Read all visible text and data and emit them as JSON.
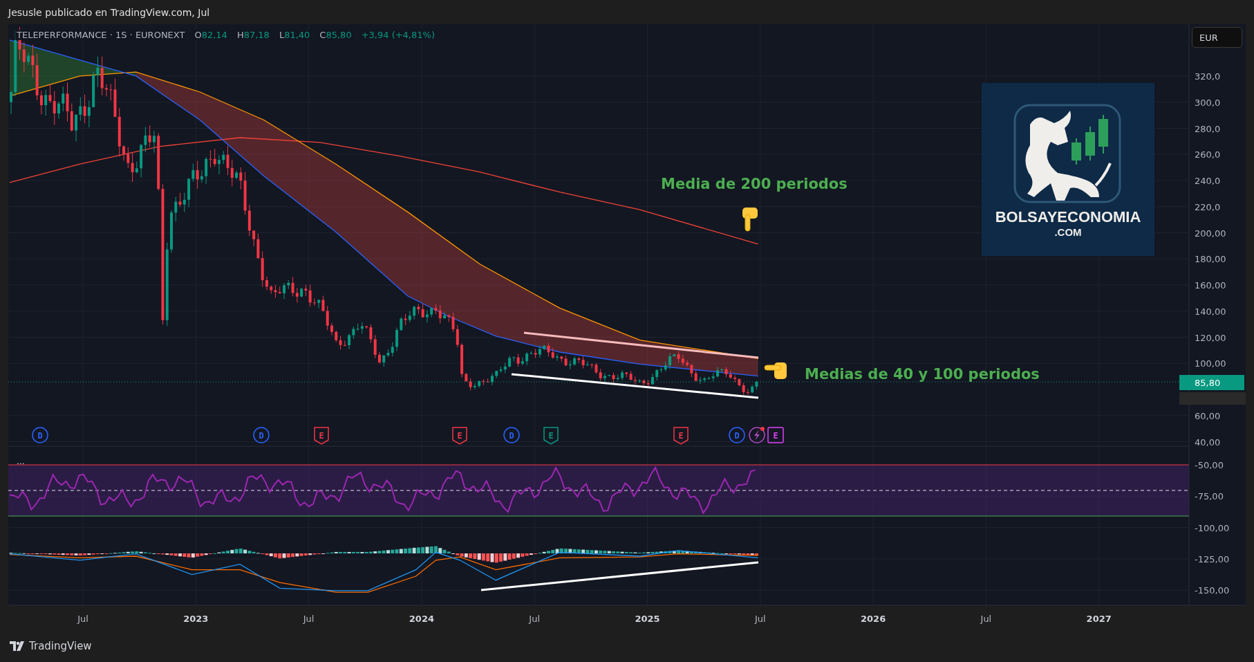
{
  "header": {
    "title": "Jesusle publicado en TradingView.com, Jul"
  },
  "legend": {
    "symbol": "TELEPERFORMANCE · 1S · EURONEXT",
    "values": [
      {
        "label": "O",
        "value": "82,14"
      },
      {
        "label": "H",
        "value": "87,18"
      },
      {
        "label": "L",
        "value": "81,40"
      },
      {
        "label": "C",
        "value": "85,80"
      }
    ],
    "change": "+3,94 (+4,81%)"
  },
  "currency_button": "EUR",
  "price_axis": {
    "ticks": [
      "320,0",
      "300,0",
      "280,0",
      "260,0",
      "240,0",
      "220,0",
      "200,00",
      "180,00",
      "160,00",
      "140,00",
      "120,00",
      "100,00",
      "60,00",
      "40,00"
    ],
    "last_price": "85,80"
  },
  "indicator_axis": {
    "ticks": [
      "-50,00",
      "-75,00",
      "-100,00",
      "-125,00",
      "-150,00"
    ]
  },
  "time_axis": {
    "ticks": [
      {
        "label": "Jul",
        "major": false
      },
      {
        "label": "2023",
        "major": true
      },
      {
        "label": "Jul",
        "major": false
      },
      {
        "label": "2024",
        "major": true
      },
      {
        "label": "Jul",
        "major": false
      },
      {
        "label": "2025",
        "major": true
      },
      {
        "label": "Jul",
        "major": false
      },
      {
        "label": "2026",
        "major": true
      },
      {
        "label": "Jul",
        "major": false
      },
      {
        "label": "2027",
        "major": true
      }
    ]
  },
  "events": [
    {
      "kind": "dividend",
      "label": "D"
    },
    {
      "kind": "dividend",
      "label": "D"
    },
    {
      "kind": "earnings",
      "label": "E",
      "color": "#f23645"
    },
    {
      "kind": "earnings",
      "label": "E",
      "color": "#f23645"
    },
    {
      "kind": "dividend",
      "label": "D"
    },
    {
      "kind": "earnings",
      "label": "E",
      "color": "#089981"
    },
    {
      "kind": "earnings",
      "label": "E",
      "color": "#f23645"
    },
    {
      "kind": "dividend",
      "label": "D"
    },
    {
      "kind": "flash"
    },
    {
      "kind": "earnings_next",
      "label": "E"
    }
  ],
  "annotations": [
    {
      "text": "Media de 200 periodos",
      "kind": "hand_down"
    },
    {
      "text": "Medias de 40 y 100 periodos",
      "kind": "hand_left"
    }
  ],
  "pane_menu": "...",
  "logo": {
    "name": "BOLSAYECONOMIA",
    "domain": ".COM"
  },
  "footer": {
    "brand": "TradingView"
  }
}
